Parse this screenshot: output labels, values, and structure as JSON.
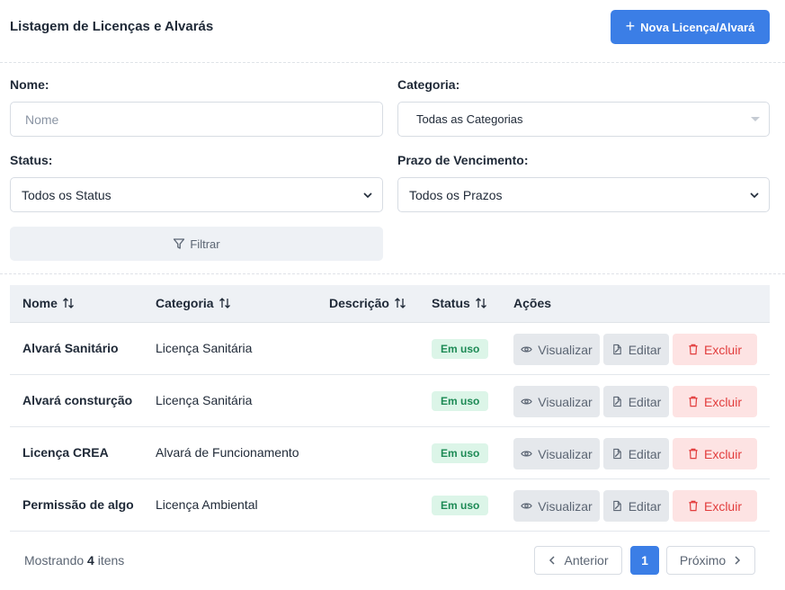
{
  "header": {
    "title": "Listagem de Licenças e Alvarás",
    "new_button": "Nova Licença/Alvará"
  },
  "filters": {
    "name_label": "Nome:",
    "name_placeholder": "Nome",
    "category_label": "Categoria:",
    "category_value": "Todas as Categorias",
    "status_label": "Status:",
    "status_value": "Todos os Status",
    "deadline_label": "Prazo de Vencimento:",
    "deadline_value": "Todos os Prazos",
    "filter_button": "Filtrar"
  },
  "table": {
    "columns": [
      "Nome",
      "Categoria",
      "Descrição",
      "Status",
      "Ações"
    ],
    "rows": [
      {
        "name": "Alvará Sanitário",
        "category": "Licença Sanitária",
        "description": "",
        "status": "Em uso"
      },
      {
        "name": "Alvará consturção",
        "category": "Licença Sanitária",
        "description": "",
        "status": "Em uso"
      },
      {
        "name": "Licença CREA",
        "category": "Alvará de Funcionamento",
        "description": "",
        "status": "Em uso"
      },
      {
        "name": "Permissão de algo",
        "category": "Licença Ambiental",
        "description": "",
        "status": "Em uso"
      }
    ],
    "actions": {
      "view": "Visualizar",
      "edit": "Editar",
      "delete": "Excluir"
    }
  },
  "footer": {
    "showing_prefix": "Mostrando",
    "count": "4",
    "showing_suffix": "itens",
    "prev": "Anterior",
    "current_page": "1",
    "next": "Próximo"
  },
  "colors": {
    "primary": "#3b7ee6",
    "status_bg": "#dcf5e8",
    "status_text": "#1d8a55",
    "danger_bg": "#fde3e3",
    "danger_text": "#e23d3d"
  }
}
